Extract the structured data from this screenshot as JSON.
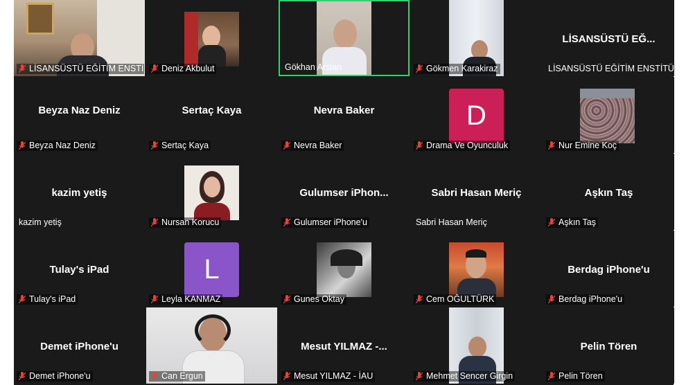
{
  "colors": {
    "background": "#1a1a1a",
    "active_border": "#23d96e",
    "muted_icon": "#e8413c",
    "avatar_d": "#cc1f58",
    "avatar_l": "#8a55c9"
  },
  "icons": {
    "muted": "mic-muted-icon"
  },
  "participants": [
    {
      "caption": "LİSANSÜSTÜ EĞİTİM ENSTİ..."
    },
    {
      "caption": "Deniz Akbulut"
    },
    {
      "caption": "Gökhan Arslan"
    },
    {
      "caption": "Gökmen Karakiraz"
    },
    {
      "tile_name": "LİSANSÜSTÜ EĞ...",
      "caption": "LİSANSÜSTÜ EĞİTİM ENSTİTÜ..."
    },
    {
      "tile_name": "Beyza Naz Deniz",
      "caption": "Beyza Naz Deniz"
    },
    {
      "tile_name": "Sertaç Kaya",
      "caption": "Sertaç Kaya"
    },
    {
      "tile_name": "Nevra Baker",
      "caption": "Nevra Baker"
    },
    {
      "avatar_letter": "D",
      "caption": "Drama Ve Oyunculuk"
    },
    {
      "caption": "Nur Emine Koç"
    },
    {
      "tile_name": "kazim yetiş",
      "caption": "kazim yetiş"
    },
    {
      "caption": "Nursan Korucu"
    },
    {
      "tile_name": "Gulumser iPhon...",
      "caption": "Gulumser iPhone'u"
    },
    {
      "tile_name": "Sabri Hasan Meriç",
      "caption": "Sabri Hasan Meriç"
    },
    {
      "tile_name": "Aşkın Taş",
      "caption": "Aşkın Taş"
    },
    {
      "tile_name": "Tulay's iPad",
      "caption": "Tulay's iPad"
    },
    {
      "avatar_letter": "L",
      "caption": "Leyla KANMAZ"
    },
    {
      "caption": "Gunes Oktay"
    },
    {
      "caption": "Cem OĞULTÜRK"
    },
    {
      "tile_name": "Berdag iPhone'u",
      "caption": "Berdag iPhone'u"
    },
    {
      "tile_name": "Demet iPhone'u",
      "caption": "Demet iPhone'u"
    },
    {
      "caption": "Can Ergun"
    },
    {
      "tile_name": "Mesut YILMAZ -...",
      "caption": "Mesut YILMAZ - İAU"
    },
    {
      "caption": "Mehmet Sencer Girgin"
    },
    {
      "tile_name": "Pelin Tören",
      "caption": "Pelin Tören"
    }
  ]
}
